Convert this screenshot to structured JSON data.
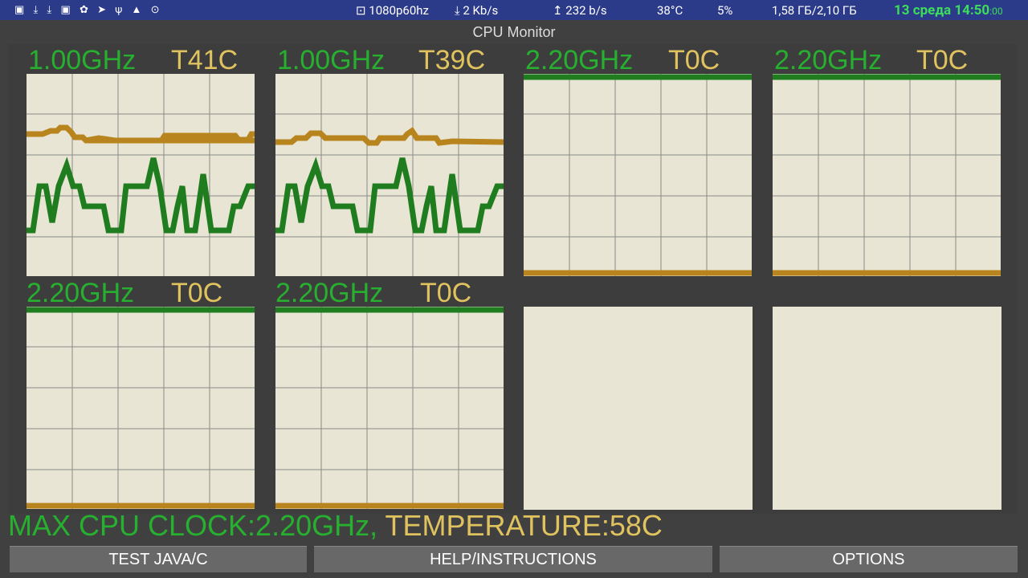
{
  "status_bar": {
    "left_icons": "▣ ⤓ ⤓ ▣ ✿ ➤ ψ ▲ ⊙",
    "video": "⊡ 1080p60hz",
    "download": "⤓ 2 Kb/s",
    "upload": "↥ 232 b/s",
    "cpu_temp": "38°C",
    "cpu_load": "5%",
    "ram": "1,58 ГБ/2,10 ГБ",
    "clock_main": "13 среда 14:50",
    "clock_seconds": ":00"
  },
  "title": "CPU Monitor",
  "cores": [
    {
      "freq": "1.00GHz",
      "temp": "T41C"
    },
    {
      "freq": "1.00GHz",
      "temp": "T39C"
    },
    {
      "freq": "2.20GHz",
      "temp": "T0C"
    },
    {
      "freq": "2.20GHz",
      "temp": "T0C"
    },
    {
      "freq": "2.20GHz",
      "temp": "T0C"
    },
    {
      "freq": "2.20GHz",
      "temp": "T0C"
    }
  ],
  "summary": {
    "clock": "MAX CPU CLOCK:2.20GHz,",
    "temperature": "TEMPERATURE:58C"
  },
  "buttons": {
    "test": "TEST JAVA/C",
    "help": "HELP/INSTRUCTIONS",
    "options": "OPTIONS"
  },
  "colors": {
    "statusbar": "#2c3a8a",
    "freq_green": "#27b02f",
    "temp_yellow": "#e0c35f",
    "graph_bg": "#e8e5d4",
    "line_green": "#1f7d1f",
    "line_orange": "#b8841d"
  }
}
